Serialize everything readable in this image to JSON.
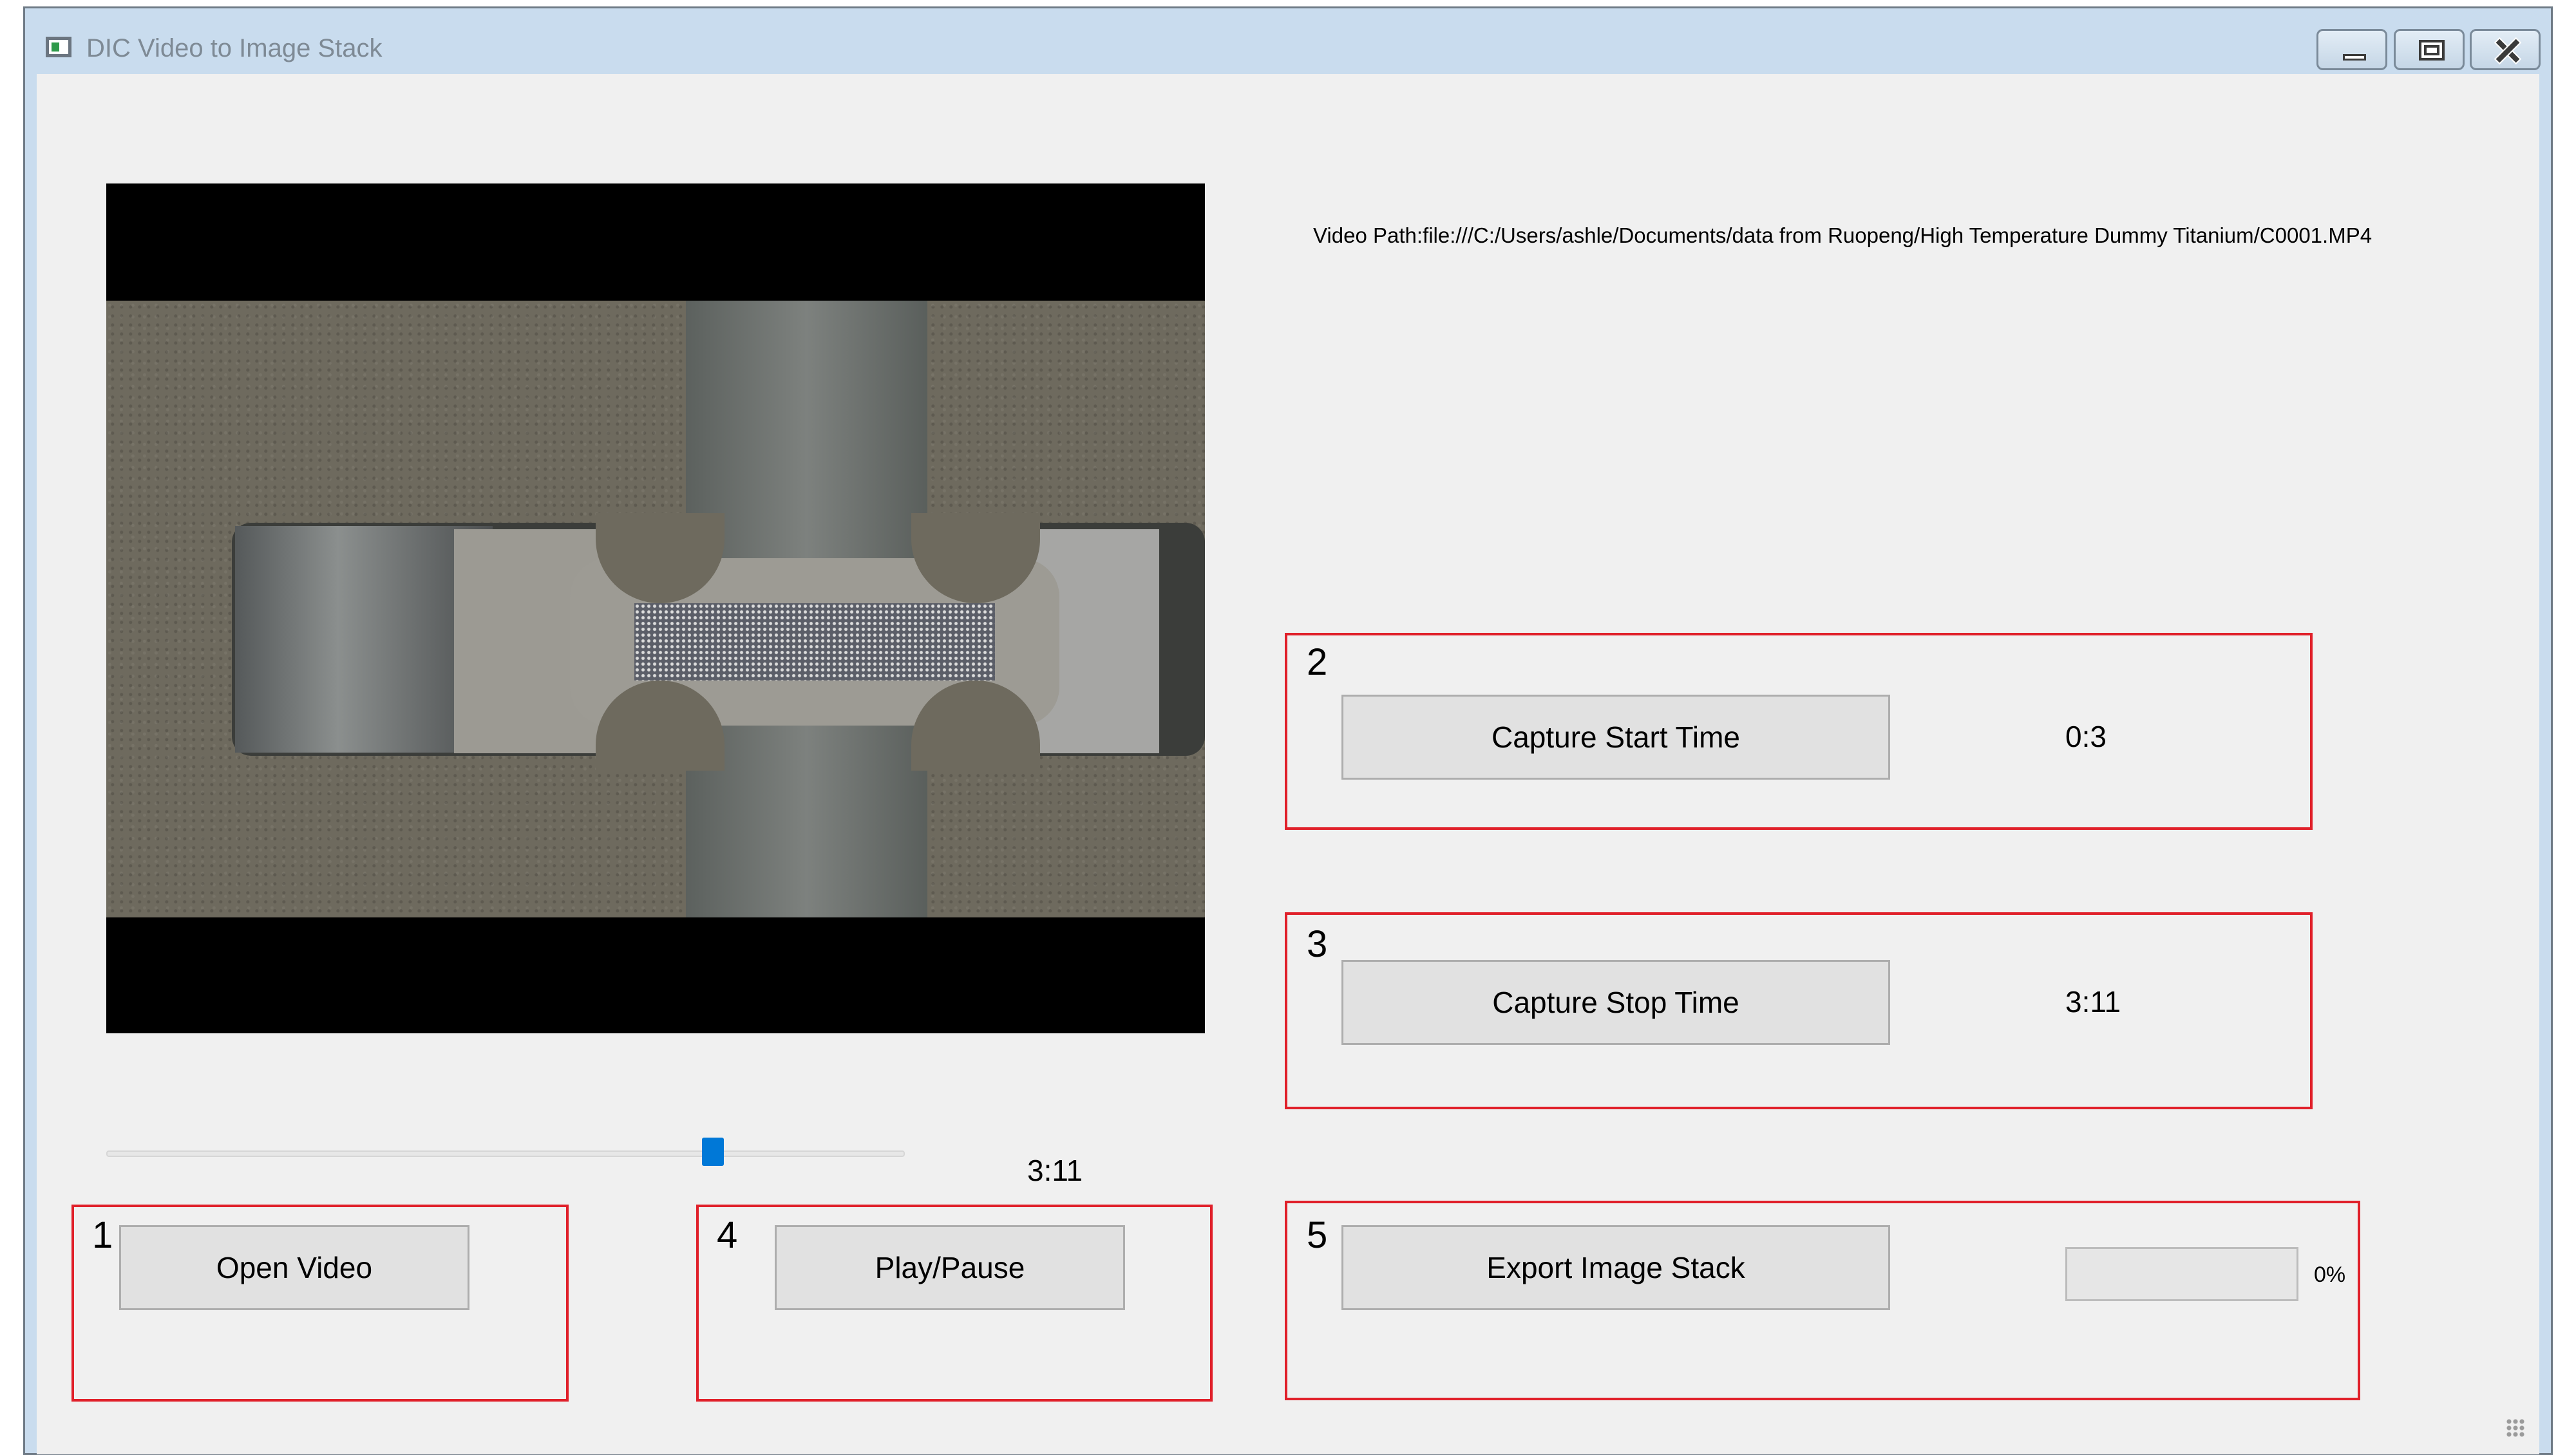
{
  "window": {
    "title": "DIC Video to Image Stack",
    "icon": "app-window-icon",
    "controls": [
      "minimize-icon",
      "maximize-icon",
      "close-icon"
    ]
  },
  "video": {
    "path_label": "Video Path:file:///C:/Users/ashle/Documents/data from Ruopeng/High Temperature Dummy Titanium/C0001.MP4",
    "current_time": "3:11",
    "position_fraction": 0.76
  },
  "steps": {
    "open": {
      "number": "1",
      "button_label": "Open Video"
    },
    "start": {
      "number": "2",
      "button_label": "Capture Start Time",
      "value": "0:3"
    },
    "stop": {
      "number": "3",
      "button_label": "Capture Stop Time",
      "value": "3:11"
    },
    "play": {
      "number": "4",
      "button_label": "Play/Pause"
    },
    "export": {
      "number": "5",
      "button_label": "Export Image Stack",
      "progress_percent": 0,
      "progress_label": "0%"
    }
  },
  "colors": {
    "highlight_box": "#e0202a",
    "slider_handle": "#0078d7",
    "title_bar": "#c9dcee"
  }
}
